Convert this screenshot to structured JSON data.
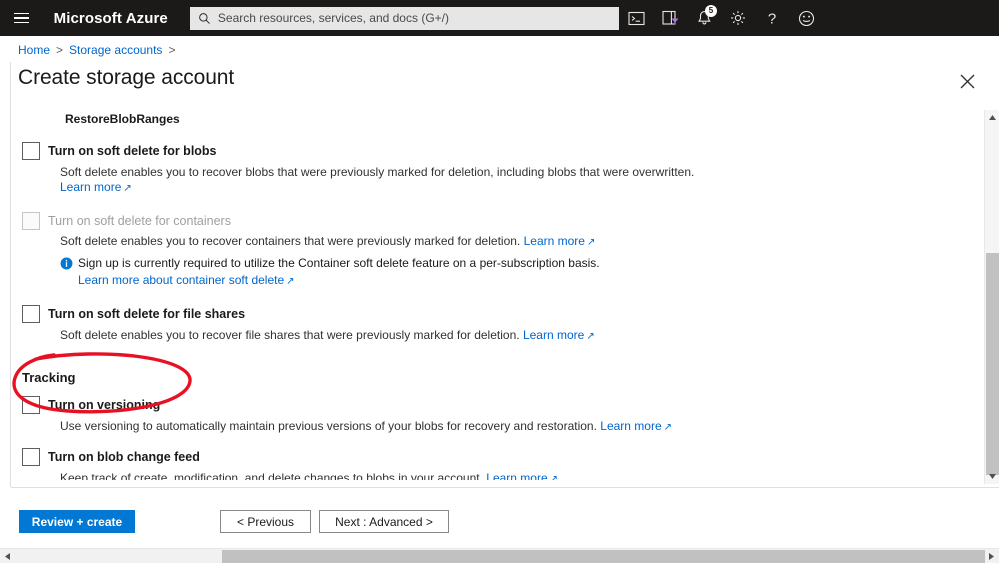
{
  "topbar": {
    "menu_icon": "hamburger-icon",
    "brand": "Microsoft Azure",
    "search": {
      "placeholder": "Search resources, services, and docs (G+/)",
      "value": "",
      "icon": "search-icon"
    },
    "icons": [
      {
        "name": "cloud-shell-icon",
        "label": "Cloud Shell"
      },
      {
        "name": "directory-filter-icon",
        "label": "Directories + subscriptions"
      },
      {
        "name": "notifications-bell-icon",
        "label": "Notifications",
        "badge": "5"
      },
      {
        "name": "settings-gear-icon",
        "label": "Settings"
      },
      {
        "name": "help-question-icon",
        "label": "Help"
      },
      {
        "name": "feedback-smiley-icon",
        "label": "Feedback"
      }
    ]
  },
  "breadcrumb": {
    "items": [
      "Home",
      "Storage accounts"
    ],
    "separator": ">"
  },
  "page": {
    "title": "Create storage account",
    "close_icon": "close-icon"
  },
  "content": {
    "restore_label": "RestoreBlobRanges",
    "options": [
      {
        "id": "soft-delete-blobs",
        "label": "Turn on soft delete for blobs",
        "checked": false,
        "disabled": false,
        "description": "Soft delete enables you to recover blobs that were previously marked for deletion, including blobs that were overwritten.",
        "link_text": "Learn more",
        "link_inline": false
      },
      {
        "id": "soft-delete-containers",
        "label": "Turn on soft delete for containers",
        "checked": false,
        "disabled": true,
        "description": "Soft delete enables you to recover containers that were previously marked for deletion.",
        "link_text": "Learn more",
        "link_inline": true,
        "info": {
          "icon": "info-circle-icon",
          "text": "Sign up is currently required to utilize the Container soft delete feature on a per-subscription basis.",
          "link_text": "Learn more about container soft delete"
        }
      },
      {
        "id": "soft-delete-file-shares",
        "label": "Turn on soft delete for file shares",
        "checked": false,
        "disabled": false,
        "description": "Soft delete enables you to recover file shares that were previously marked for deletion.",
        "link_text": "Learn more",
        "link_inline": true
      }
    ],
    "tracking_heading": "Tracking",
    "tracking_options": [
      {
        "id": "versioning",
        "label": "Turn on versioning",
        "checked": false,
        "disabled": false,
        "description": "Use versioning to automatically maintain previous versions of your blobs for recovery and restoration.",
        "link_text": "Learn more",
        "link_inline": true,
        "annotated": true
      },
      {
        "id": "blob-change-feed",
        "label": "Turn on blob change feed",
        "checked": false,
        "disabled": false,
        "description": "Keep track of create, modification, and delete changes to blobs in your account.",
        "link_text": "Learn more",
        "link_inline": true
      }
    ]
  },
  "footer": {
    "review_create": "Review + create",
    "previous": "< Previous",
    "next": "Next : Advanced >"
  },
  "annotation": {
    "shape": "hand-drawn-ellipse",
    "color": "#e81123",
    "target": "Turn on versioning"
  },
  "colors": {
    "accent": "#0078d4",
    "link": "#0066cc",
    "topbar_bg": "#1b1a119",
    "annotation_red": "#e81123"
  }
}
